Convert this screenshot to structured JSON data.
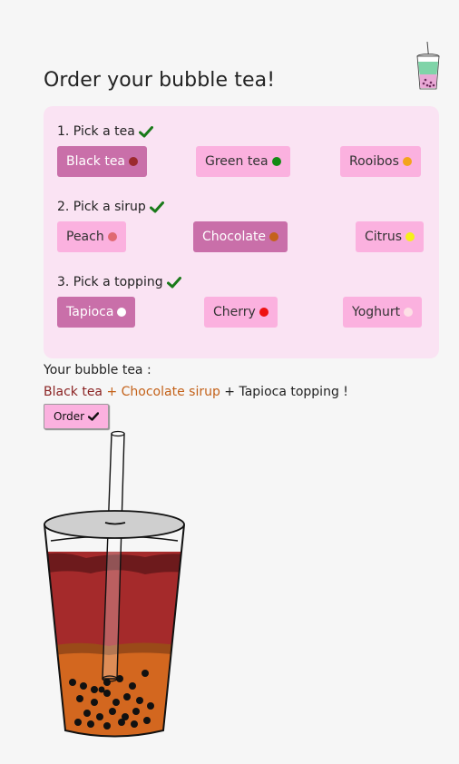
{
  "header": {
    "title": "Order your bubble tea!",
    "logo_icon": "bubble-tea-cup-icon"
  },
  "steps": [
    {
      "label": "1. Pick a tea",
      "completed": true,
      "options": [
        {
          "label": "Black tea",
          "color": "#9b2a2e",
          "selected": true
        },
        {
          "label": "Green tea",
          "color": "#138a13",
          "selected": false
        },
        {
          "label": "Rooibos",
          "color": "#f3a41b",
          "selected": false
        }
      ]
    },
    {
      "label": "2. Pick a sirup",
      "completed": true,
      "options": [
        {
          "label": "Peach",
          "color": "#e06a72",
          "selected": false
        },
        {
          "label": "Chocolate",
          "color": "#c4621a",
          "selected": true
        },
        {
          "label": "Citrus",
          "color": "#f6ef1a",
          "selected": false
        }
      ]
    },
    {
      "label": "3. Pick a topping",
      "completed": true,
      "options": [
        {
          "label": "Tapioca",
          "color": "#ffffff",
          "selected": true
        },
        {
          "label": "Cherry",
          "color": "#ee1111",
          "selected": false
        },
        {
          "label": "Yoghurt",
          "color": "#fde0e6",
          "selected": false
        }
      ]
    }
  ],
  "summary": {
    "label": "Your bubble tea :",
    "tea": "Black tea",
    "sirup": " + Chocolate sirup",
    "topping": " + Tapioca topping !"
  },
  "order_button": {
    "label": "Order"
  },
  "colors": {
    "accent": "#fbb1df",
    "selected": "#c96fa9",
    "panel": "#fae3f3",
    "check": "#1a7a1a",
    "tea_text": "#8b2424",
    "sirup_text": "#c4621a"
  }
}
